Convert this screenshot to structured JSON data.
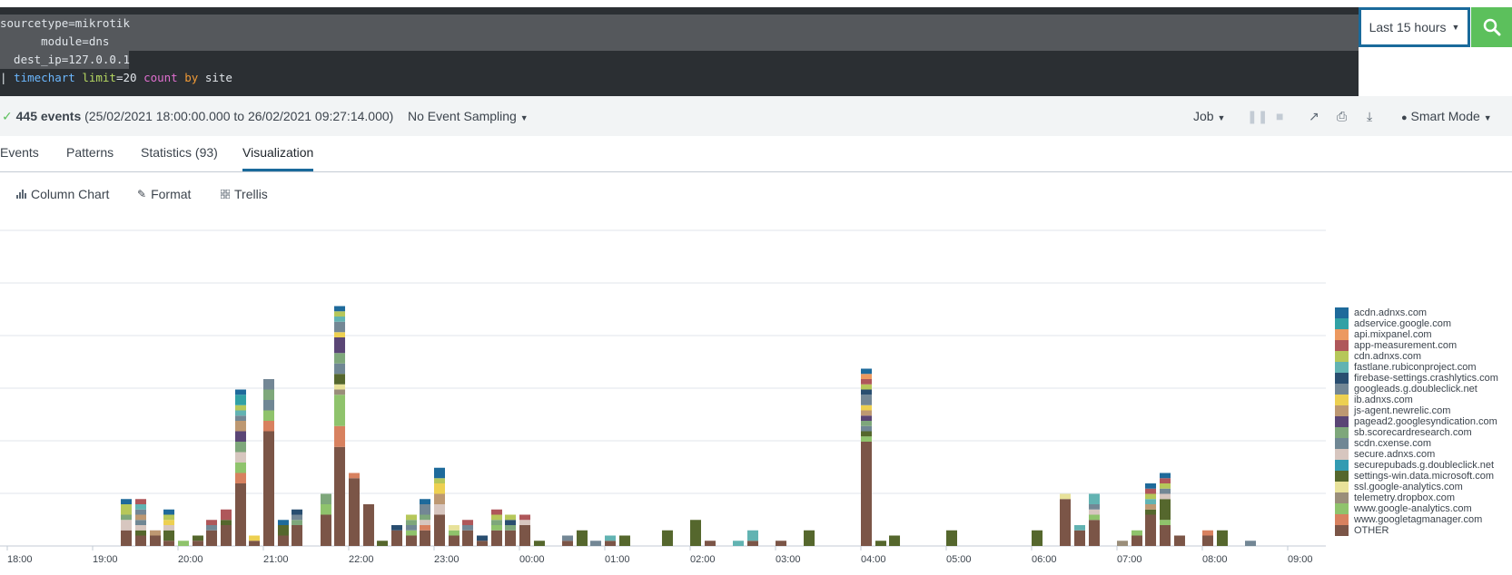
{
  "search": {
    "line1": "sourcetype=mikrotik",
    "line2": "      module=dns",
    "line3": "  dest_ip=127.0.0.1",
    "pipe": "| ",
    "cmd": "timechart",
    "arg_key": "limit",
    "arg_eq": "=20 ",
    "fn": "count",
    "by": "by",
    "field": " site"
  },
  "time_picker": {
    "label": "Last 15 hours"
  },
  "status": {
    "check": "✓",
    "count": "445 events",
    "range": "(25/02/2021 18:00:00.000 to 26/02/2021 09:27:14.000)",
    "sampling": "No Event Sampling",
    "job": "Job",
    "mode": "Smart Mode"
  },
  "tabs": [
    "Events",
    "Patterns",
    "Statistics (93)",
    "Visualization"
  ],
  "viz_toolbar": {
    "chart_type": "Column Chart",
    "format": "Format",
    "trellis": "Trellis"
  },
  "colors": {
    "accent": "#1a6a9b",
    "search_btn": "#5cc05c",
    "bg_dark": "#2b2f33"
  },
  "chart_data": {
    "type": "bar",
    "stacked": true,
    "xlabel": "",
    "ylabel": "",
    "x_ticks": [
      "18:00",
      "19:00",
      "20:00",
      "21:00",
      "22:00",
      "23:00",
      "00:00",
      "01:00",
      "02:00",
      "03:00",
      "04:00",
      "05:00",
      "06:00",
      "07:00",
      "08:00",
      "09:00"
    ],
    "legend_position": "right",
    "grid": true,
    "series": [
      {
        "name": "acdn.adnxs.com",
        "color": "#1e6a9b"
      },
      {
        "name": "adservice.google.com",
        "color": "#31a1a5"
      },
      {
        "name": "api.mixpanel.com",
        "color": "#ec9960"
      },
      {
        "name": "app-measurement.com",
        "color": "#af575a"
      },
      {
        "name": "cdn.adnxs.com",
        "color": "#b6c75a"
      },
      {
        "name": "fastlane.rubiconproject.com",
        "color": "#62b3b2"
      },
      {
        "name": "firebase-settings.crashlytics.com",
        "color": "#294e70"
      },
      {
        "name": "googleads.g.doubleclick.net",
        "color": "#738795"
      },
      {
        "name": "ib.adnxs.com",
        "color": "#edd051"
      },
      {
        "name": "js-agent.newrelic.com",
        "color": "#bd9872"
      },
      {
        "name": "pagead2.googlesyndication.com",
        "color": "#5a4575"
      },
      {
        "name": "sb.scorecardresearch.com",
        "color": "#7ea77b"
      },
      {
        "name": "scdn.cxense.com",
        "color": "#708794"
      },
      {
        "name": "secure.adnxs.com",
        "color": "#d7c6bf"
      },
      {
        "name": "securepubads.g.doubleclick.net",
        "color": "#339bb2"
      },
      {
        "name": "settings-win.data.microsoft.com",
        "color": "#55672d"
      },
      {
        "name": "ssl.google-analytics.com",
        "color": "#e8e29a"
      },
      {
        "name": "telemetry.dropbox.com",
        "color": "#9a8e7a"
      },
      {
        "name": "www.google-analytics.com",
        "color": "#8fc36c"
      },
      {
        "name": "www.googletagmanager.com",
        "color": "#d8815f"
      },
      {
        "name": "OTHER",
        "color": "#7b5547"
      }
    ],
    "bins": [
      {
        "t": 19.33,
        "v": {
          "OTHER": 3,
          "secure.adnxs.com": 2,
          "cdn.adnxs.com": 2,
          "sb.scorecardresearch.com": 1,
          "acdn.adnxs.com": 1
        }
      },
      {
        "t": 19.5,
        "v": {
          "OTHER": 2,
          "settings-win.data.microsoft.com": 1,
          "js-agent.newrelic.com": 1,
          "googleads.g.doubleclick.net": 1,
          "secure.adnxs.com": 1,
          "scdn.cxense.com": 1,
          "fastlane.rubiconproject.com": 1,
          "app-measurement.com": 1
        }
      },
      {
        "t": 19.67,
        "v": {
          "OTHER": 2,
          "js-agent.newrelic.com": 1
        }
      },
      {
        "t": 19.83,
        "v": {
          "OTHER": 1,
          "secure.adnxs.com": 1,
          "settings-win.data.microsoft.com": 2,
          "cdn.adnxs.com": 1,
          "ib.adnxs.com": 1,
          "acdn.adnxs.com": 1
        }
      },
      {
        "t": 20.0,
        "v": {
          "www.google-analytics.com": 1
        }
      },
      {
        "t": 20.17,
        "v": {
          "OTHER": 1,
          "settings-win.data.microsoft.com": 1
        }
      },
      {
        "t": 20.33,
        "v": {
          "OTHER": 3,
          "app-measurement.com": 1,
          "googleads.g.doubleclick.net": 1
        }
      },
      {
        "t": 20.5,
        "v": {
          "OTHER": 4,
          "settings-win.data.microsoft.com": 1,
          "app-measurement.com": 2
        }
      },
      {
        "t": 20.67,
        "v": {
          "OTHER": 12,
          "www.google-analytics.com": 2,
          "www.googletagmanager.com": 2,
          "secure.adnxs.com": 2,
          "fastlane.rubiconproject.com": 1,
          "sb.scorecardresearch.com": 2,
          "pagead2.googlesyndication.com": 2,
          "js-agent.newrelic.com": 2,
          "googleads.g.doubleclick.net": 1,
          "cdn.adnxs.com": 1,
          "adservice.google.com": 2,
          "acdn.adnxs.com": 1
        }
      },
      {
        "t": 20.83,
        "v": {
          "OTHER": 1,
          "ib.adnxs.com": 1
        }
      },
      {
        "t": 21.0,
        "v": {
          "OTHER": 22,
          "www.googletagmanager.com": 2,
          "www.google-analytics.com": 2,
          "scdn.cxense.com": 2,
          "googleads.g.doubleclick.net": 2,
          "sb.scorecardresearch.com": 2
        }
      },
      {
        "t": 21.17,
        "v": {
          "OTHER": 2,
          "settings-win.data.microsoft.com": 2,
          "acdn.adnxs.com": 1
        }
      },
      {
        "t": 21.33,
        "v": {
          "OTHER": 4,
          "googleads.g.doubleclick.net": 1,
          "firebase-settings.crashlytics.com": 1,
          "sb.scorecardresearch.com": 1
        }
      },
      {
        "t": 21.67,
        "v": {
          "OTHER": 6,
          "www.google-analytics.com": 2,
          "sb.scorecardresearch.com": 2
        }
      },
      {
        "t": 21.83,
        "v": {
          "OTHER": 19,
          "www.googletagmanager.com": 4,
          "www.google-analytics.com": 6,
          "telemetry.dropbox.com": 1,
          "ssl.google-analytics.com": 1,
          "settings-win.data.microsoft.com": 2,
          "scdn.cxense.com": 2,
          "pagead2.googlesyndication.com": 3,
          "ib.adnxs.com": 1,
          "googleads.g.doubleclick.net": 2,
          "fastlane.rubiconproject.com": 1,
          "cdn.adnxs.com": 1,
          "sb.scorecardresearch.com": 2,
          "acdn.adnxs.com": 1
        }
      },
      {
        "t": 22.0,
        "v": {
          "OTHER": 13,
          "www.googletagmanager.com": 1
        }
      },
      {
        "t": 22.17,
        "v": {
          "OTHER": 8
        }
      },
      {
        "t": 22.33,
        "v": {
          "settings-win.data.microsoft.com": 1
        }
      },
      {
        "t": 22.5,
        "v": {
          "OTHER": 3,
          "firebase-settings.crashlytics.com": 1
        }
      },
      {
        "t": 22.67,
        "v": {
          "OTHER": 2,
          "cdn.adnxs.com": 1,
          "scdn.cxense.com": 1,
          "www.google-analytics.com": 1,
          "sb.scorecardresearch.com": 1
        }
      },
      {
        "t": 22.83,
        "v": {
          "OTHER": 3,
          "www.googletagmanager.com": 1,
          "secure.adnxs.com": 1,
          "googleads.g.doubleclick.net": 2,
          "sb.scorecardresearch.com": 1,
          "acdn.adnxs.com": 1
        }
      },
      {
        "t": 23.0,
        "v": {
          "OTHER": 6,
          "secure.adnxs.com": 2,
          "js-agent.newrelic.com": 2,
          "ib.adnxs.com": 2,
          "cdn.adnxs.com": 1,
          "acdn.adnxs.com": 2
        }
      },
      {
        "t": 23.17,
        "v": {
          "OTHER": 2,
          "ssl.google-analytics.com": 1,
          "www.google-analytics.com": 1
        }
      },
      {
        "t": 23.33,
        "v": {
          "OTHER": 3,
          "app-measurement.com": 1,
          "googleads.g.doubleclick.net": 1
        }
      },
      {
        "t": 23.5,
        "v": {
          "OTHER": 1,
          "firebase-settings.crashlytics.com": 1
        }
      },
      {
        "t": 23.67,
        "v": {
          "OTHER": 3,
          "www.google-analytics.com": 1,
          "app-measurement.com": 1,
          "cdn.adnxs.com": 1,
          "sb.scorecardresearch.com": 1
        }
      },
      {
        "t": 23.83,
        "v": {
          "OTHER": 3,
          "cdn.adnxs.com": 1,
          "firebase-settings.crashlytics.com": 1,
          "sb.scorecardresearch.com": 1
        }
      },
      {
        "t": 24.0,
        "v": {
          "OTHER": 4,
          "secure.adnxs.com": 1,
          "app-measurement.com": 1
        }
      },
      {
        "t": 24.17,
        "v": {
          "settings-win.data.microsoft.com": 1
        }
      },
      {
        "t": 24.5,
        "v": {
          "OTHER": 1,
          "googleads.g.doubleclick.net": 1
        }
      },
      {
        "t": 24.67,
        "v": {
          "settings-win.data.microsoft.com": 3
        }
      },
      {
        "t": 24.83,
        "v": {
          "googleads.g.doubleclick.net": 1
        }
      },
      {
        "t": 25.0,
        "v": {
          "OTHER": 1,
          "fastlane.rubiconproject.com": 1
        }
      },
      {
        "t": 25.17,
        "v": {
          "settings-win.data.microsoft.com": 2
        }
      },
      {
        "t": 25.67,
        "v": {
          "settings-win.data.microsoft.com": 3
        }
      },
      {
        "t": 26.0,
        "v": {
          "settings-win.data.microsoft.com": 5
        }
      },
      {
        "t": 26.17,
        "v": {
          "OTHER": 1
        }
      },
      {
        "t": 26.5,
        "v": {
          "fastlane.rubiconproject.com": 1
        }
      },
      {
        "t": 26.67,
        "v": {
          "OTHER": 1,
          "fastlane.rubiconproject.com": 2
        }
      },
      {
        "t": 27.0,
        "v": {
          "OTHER": 1
        }
      },
      {
        "t": 27.33,
        "v": {
          "settings-win.data.microsoft.com": 3
        }
      },
      {
        "t": 28.0,
        "v": {
          "OTHER": 20,
          "www.google-analytics.com": 1,
          "settings-win.data.microsoft.com": 1,
          "sb.scorecardresearch.com": 1,
          "firebase-settings.crashlytics.com": 1,
          "pagead2.googlesyndication.com": 1,
          "js-agent.newrelic.com": 1,
          "ib.adnxs.com": 1,
          "googleads.g.doubleclick.net": 2,
          "scdn.cxense.com": 1,
          "cdn.adnxs.com": 1,
          "app-measurement.com": 1,
          "api.mixpanel.com": 1,
          "acdn.adnxs.com": 1
        }
      },
      {
        "t": 28.17,
        "v": {
          "settings-win.data.microsoft.com": 1
        }
      },
      {
        "t": 28.33,
        "v": {
          "settings-win.data.microsoft.com": 2
        }
      },
      {
        "t": 29.0,
        "v": {
          "settings-win.data.microsoft.com": 3
        }
      },
      {
        "t": 30.0,
        "v": {
          "settings-win.data.microsoft.com": 3
        }
      },
      {
        "t": 30.33,
        "v": {
          "OTHER": 9,
          "ssl.google-analytics.com": 1
        }
      },
      {
        "t": 30.5,
        "v": {
          "OTHER": 3,
          "fastlane.rubiconproject.com": 1
        }
      },
      {
        "t": 30.67,
        "v": {
          "OTHER": 5,
          "secure.adnxs.com": 1,
          "www.google-analytics.com": 1,
          "googleads.g.doubleclick.net": 1,
          "fastlane.rubiconproject.com": 2
        }
      },
      {
        "t": 31.0,
        "v": {
          "telemetry.dropbox.com": 1
        }
      },
      {
        "t": 31.17,
        "v": {
          "OTHER": 2,
          "www.google-analytics.com": 1
        }
      },
      {
        "t": 31.33,
        "v": {
          "OTHER": 6,
          "settings-win.data.microsoft.com": 1,
          "js-agent.newrelic.com": 1,
          "cdn.adnxs.com": 1,
          "app-measurement.com": 1,
          "fastlane.rubiconproject.com": 1,
          "acdn.adnxs.com": 1
        }
      },
      {
        "t": 31.5,
        "v": {
          "OTHER": 4,
          "settings-win.data.microsoft.com": 4,
          "www.google-analytics.com": 1,
          "secure.adnxs.com": 1,
          "cdn.adnxs.com": 1,
          "googleads.g.doubleclick.net": 1,
          "app-measurement.com": 1,
          "acdn.adnxs.com": 1
        }
      },
      {
        "t": 31.67,
        "v": {
          "OTHER": 2
        }
      },
      {
        "t": 32.0,
        "v": {
          "OTHER": 2,
          "www.googletagmanager.com": 1
        }
      },
      {
        "t": 32.17,
        "v": {
          "settings-win.data.microsoft.com": 3
        }
      },
      {
        "t": 32.5,
        "v": {
          "googleads.g.doubleclick.net": 1
        }
      }
    ]
  }
}
